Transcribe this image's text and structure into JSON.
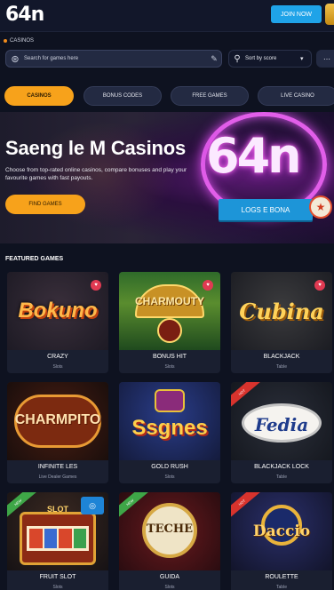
{
  "header": {
    "logo": "64n",
    "action_button": "JOIN NOW"
  },
  "breadcrumb": "CASINOS",
  "search": {
    "placeholder": "Search for games here",
    "filter_label": "Sort by score"
  },
  "tabs": [
    {
      "label": "CASINOS",
      "active": true
    },
    {
      "label": "BONUS CODES",
      "active": false
    },
    {
      "label": "FREE GAMES",
      "active": false
    },
    {
      "label": "LIVE CASINO",
      "active": false
    }
  ],
  "hero": {
    "title": "Saeng le M Casinos",
    "subtitle": "Choose from top-rated online casinos, compare bonuses and play your favourite games with fast payouts.",
    "button": "FIND GAMES",
    "big_logo": "64n",
    "cta": "LOGS E BONA"
  },
  "section_title": "FEATURED GAMES",
  "games": [
    {
      "art_title": "Bokuno",
      "name": "CRAZY",
      "sub": "Slots",
      "fav": "♥",
      "ribbon": "",
      "badge": ""
    },
    {
      "art_title": "CHARMOUTY",
      "name": "BONUS HIT",
      "sub": "Slots",
      "fav": "♥",
      "ribbon": "",
      "badge": ""
    },
    {
      "art_title": "Cubina",
      "name": "BLACKJACK",
      "sub": "Table",
      "fav": "♥",
      "ribbon": "",
      "badge": ""
    },
    {
      "art_title": "CHARMPITO",
      "name": "INFINITE LES",
      "sub": "Live Dealer Games",
      "fav": "",
      "ribbon": "",
      "badge": ""
    },
    {
      "art_title": "Ssgnes",
      "name": "GOLD RUSH",
      "sub": "Slots",
      "fav": "",
      "ribbon": "",
      "badge": ""
    },
    {
      "art_title": "Fedia",
      "name": "BLACKJACK LOCK",
      "sub": "Table",
      "fav": "",
      "ribbon": "HOT",
      "badge": ""
    },
    {
      "art_title": "SLOT",
      "name": "FRUIT SLOT",
      "sub": "Slots",
      "fav": "",
      "ribbon": "NEW",
      "badge": "◎"
    },
    {
      "art_title": "TECHE",
      "name": "GUIDA",
      "sub": "Slots",
      "fav": "",
      "ribbon": "NEW",
      "badge": ""
    },
    {
      "art_title": "Daccio",
      "name": "ROULETTE",
      "sub": "Table",
      "fav": "",
      "ribbon": "HOT",
      "badge": ""
    }
  ],
  "colors": {
    "accent": "#f7a21b",
    "primary_blue": "#1fa3e8",
    "background": "#0e1220",
    "neon": "#e15ee9"
  }
}
